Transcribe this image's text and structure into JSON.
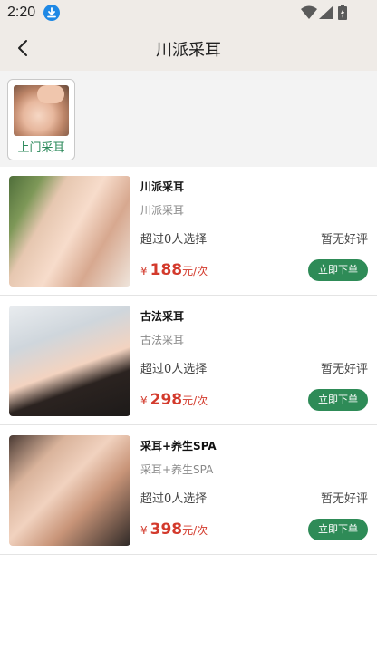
{
  "status_bar": {
    "time": "2:20"
  },
  "nav": {
    "title": "川派采耳"
  },
  "categories": [
    {
      "label": "上门采耳"
    }
  ],
  "services": [
    {
      "name": "川派采耳",
      "subtitle": "川派采耳",
      "count_text": "超过0人选择",
      "review_text": "暂无好评",
      "currency": "¥",
      "price": "188",
      "unit": "元/次",
      "button": "立即下单"
    },
    {
      "name": "古法采耳",
      "subtitle": "古法采耳",
      "count_text": "超过0人选择",
      "review_text": "暂无好评",
      "currency": "¥",
      "price": "298",
      "unit": "元/次",
      "button": "立即下单"
    },
    {
      "name": "采耳+养生SPA",
      "subtitle": "采耳+养生SPA",
      "count_text": "超过0人选择",
      "review_text": "暂无好评",
      "currency": "¥",
      "price": "398",
      "unit": "元/次",
      "button": "立即下单"
    }
  ],
  "colors": {
    "accent_green": "#2e8b57",
    "price_red": "#d33a2c",
    "header_bg": "#efebe7"
  },
  "icons": [
    "download-icon",
    "wifi-icon",
    "signal-icon",
    "battery-icon",
    "back-arrow-icon"
  ]
}
